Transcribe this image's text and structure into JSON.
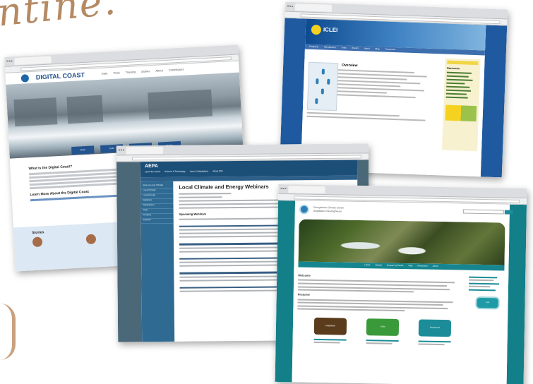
{
  "heading_script": "ntine.",
  "shots": {
    "digital_coast": {
      "logo": "DIGITAL COAST",
      "nav": [
        "Data",
        "Tools",
        "Training",
        "Stories",
        "About",
        "Contributors"
      ],
      "buttons": [
        "Data",
        "Tools",
        "Training",
        "Stories"
      ],
      "section_title": "What is the Digital Coast?",
      "link_heading": "Learn More About the Digital Coast",
      "panel_heading": "Stories"
    },
    "iclei": {
      "brand": "ICLEI",
      "menu": [
        "Programs",
        "Membership",
        "Tools",
        "Events",
        "About",
        "Blog",
        "Resources"
      ],
      "page_title": "Overview",
      "side_title": "Resources"
    },
    "aepa": {
      "brand": "AEPA",
      "sub_links": [
        "Learn the Issues",
        "Science & Technology",
        "Laws & Regulations",
        "About EPA"
      ],
      "left_nav": [
        "State & Local Climate",
        "Local Climate",
        "Local Energy",
        "Webinars",
        "Publications",
        "Tools",
        "Funding",
        "Partners"
      ],
      "title": "Local Climate and Energy Webinars",
      "section": "Upcoming Webinars"
    },
    "climate": {
      "logo_line1": "Georgetown Climate Center",
      "logo_line2": "Adaptation Clearinghouse",
      "nav": [
        "Home",
        "Search",
        "Browse by Sector",
        "Map",
        "Resources",
        "About"
      ],
      "heading1": "Welcome",
      "heading2": "Featured",
      "cta": "Join",
      "tiles": [
        "Adaptation",
        "Tools",
        "Resources"
      ],
      "tile_colors": [
        "#5a3b1c",
        "#3a9a3a",
        "#1c8d98"
      ]
    }
  }
}
